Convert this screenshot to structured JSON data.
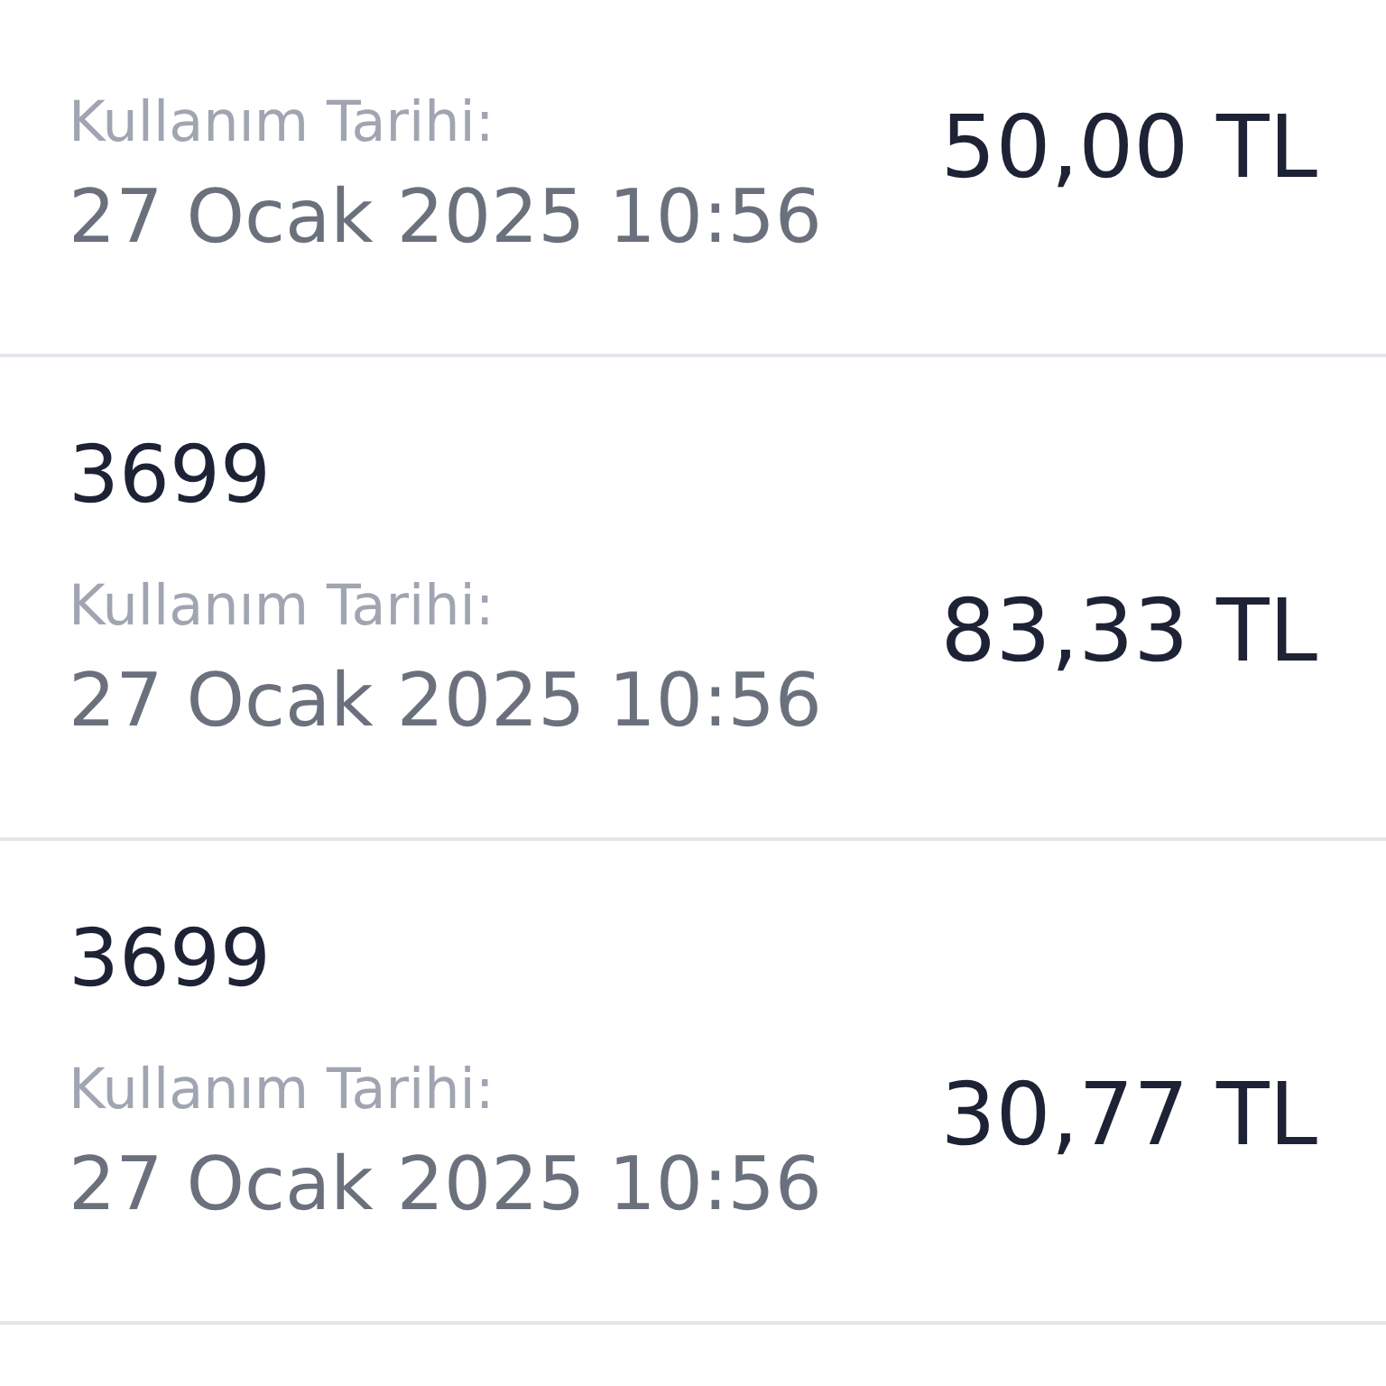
{
  "transactions": [
    {
      "date_label": "Kullanım Tarihi:",
      "date": "27 Ocak 2025 10:56",
      "amount": "50,00 TL"
    },
    {
      "code": "3699",
      "date_label": "Kullanım Tarihi:",
      "date": "27 Ocak 2025 10:56",
      "amount": "83,33 TL"
    },
    {
      "code": "3699",
      "date_label": "Kullanım Tarihi:",
      "date": "27 Ocak 2025 10:56",
      "amount": "30,77 TL"
    }
  ]
}
